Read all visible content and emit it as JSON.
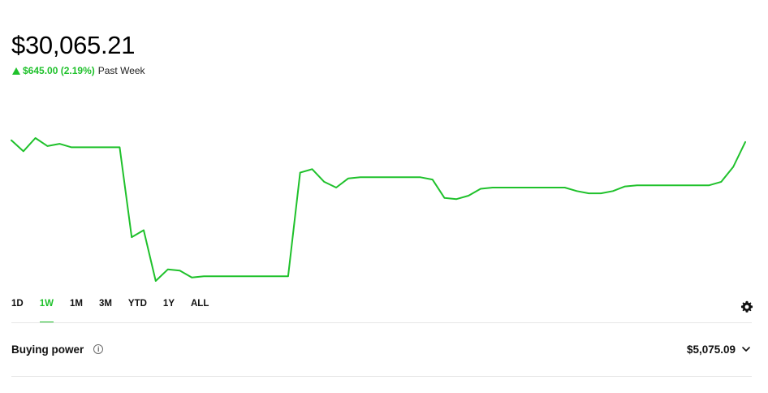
{
  "portfolio": {
    "balance": "$30,065.21",
    "change_amount": "$645.00 (2.19%)",
    "change_period": "Past Week",
    "change_direction_icon": "arrow-up-icon"
  },
  "colors": {
    "accent": "#1fc12b",
    "text": "#111111",
    "divider": "#e6e6e6"
  },
  "chart_data": {
    "type": "line",
    "title": "",
    "xlabel": "",
    "ylabel": "",
    "grid": false,
    "legend": "none",
    "series": [
      {
        "values": [
          30080,
          29985,
          30100,
          30030,
          30050,
          30020,
          30020,
          30020,
          30020,
          30020,
          29240,
          29300,
          28860,
          28960,
          28950,
          28890,
          28900,
          28900,
          28900,
          28900,
          28900,
          28900,
          28900,
          28900,
          29800,
          29830,
          29720,
          29670,
          29750,
          29760,
          29760,
          29760,
          29760,
          29760,
          29760,
          29740,
          29580,
          29570,
          29600,
          29660,
          29670,
          29670,
          29670,
          29670,
          29670,
          29670,
          29670,
          29640,
          29620,
          29620,
          29640,
          29680,
          29690,
          29690,
          29690,
          29690,
          29690,
          29690,
          29690,
          29720,
          29850,
          30065.21
        ]
      }
    ]
  },
  "range_tabs": [
    {
      "label": "1D",
      "active": false
    },
    {
      "label": "1W",
      "active": true
    },
    {
      "label": "1M",
      "active": false
    },
    {
      "label": "3M",
      "active": false
    },
    {
      "label": "YTD",
      "active": false
    },
    {
      "label": "1Y",
      "active": false
    },
    {
      "label": "ALL",
      "active": false
    }
  ],
  "settings_icon": "gear-icon",
  "buying_power": {
    "label": "Buying power",
    "info_icon": "info-icon",
    "value": "$5,075.09",
    "expand_icon": "chevron-down-icon"
  }
}
